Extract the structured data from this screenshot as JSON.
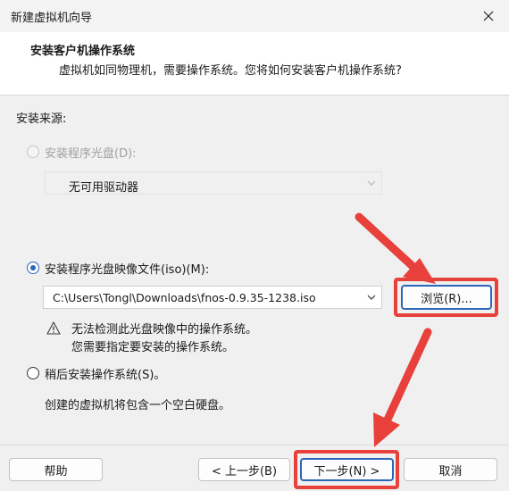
{
  "window": {
    "title": "新建虚拟机向导"
  },
  "header": {
    "title": "安装客户机操作系统",
    "subtitle": "虚拟机如同物理机，需要操作系统。您将如何安装客户机操作系统?"
  },
  "install_source": {
    "label": "安装来源:",
    "optical_drive": {
      "label": "安装程序光盘(D):",
      "selected": false,
      "enabled": false,
      "drive_value": "无可用驱动器"
    },
    "iso": {
      "label": "安装程序光盘映像文件(iso)(M):",
      "selected": true,
      "path_value": "C:\\Users\\Tongl\\Downloads\\fnos-0.9.35-1238.iso",
      "browse_label": "浏览(R)..."
    },
    "warning": {
      "line1": "无法检测此光盘映像中的操作系统。",
      "line2": "您需要指定要安装的操作系统。"
    },
    "later": {
      "label": "稍后安装操作系统(S)。",
      "selected": false,
      "description": "创建的虚拟机将包含一个空白硬盘。"
    }
  },
  "footer": {
    "help": "帮助",
    "back": "< 上一步(B)",
    "next": "下一步(N) >",
    "cancel": "取消"
  },
  "annotation_color": "#e8403b",
  "accent_color": "#2c66b8"
}
